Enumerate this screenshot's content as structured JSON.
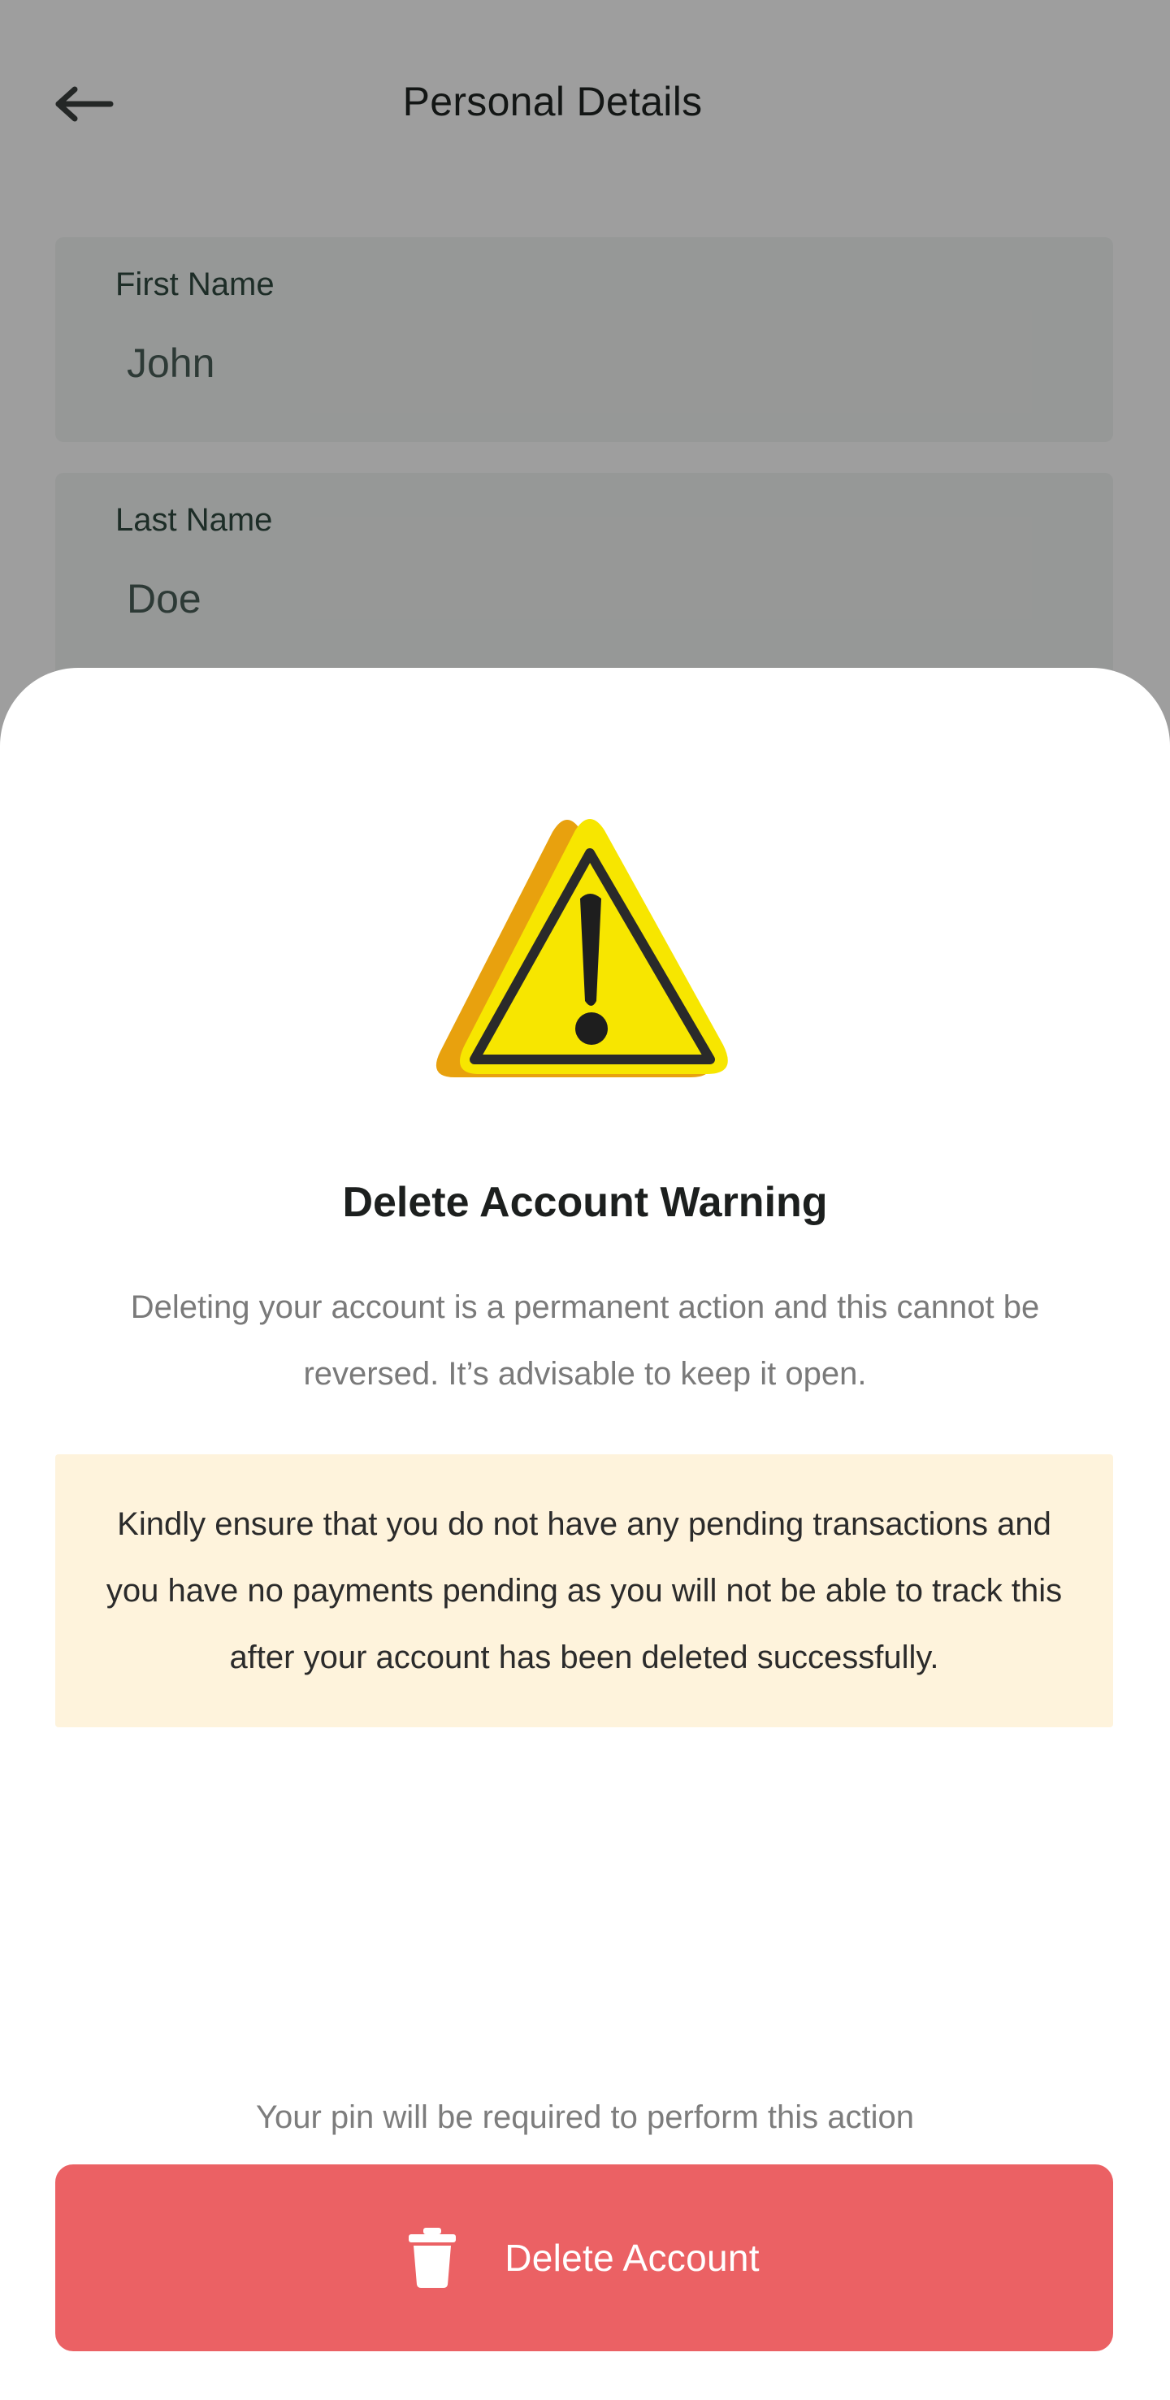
{
  "header": {
    "back_icon": "arrow-left-icon",
    "title": "Personal Details"
  },
  "form": {
    "fields": [
      {
        "label": "First Name",
        "value": "John"
      },
      {
        "label": "Last Name",
        "value": "Doe"
      }
    ]
  },
  "sheet": {
    "illustration": "warning-triangle-icon",
    "title": "Delete Account Warning",
    "description": "Deleting your account is a permanent action and this cannot be reversed. It’s advisable to keep it open.",
    "notice": "Kindly ensure that you do not have any pending transactions and you have no payments pending as you will not be able to track this after your account has been deleted successfully.",
    "pin_note": "Your pin will be required to perform this action",
    "delete_button": {
      "label": "Delete Account",
      "icon": "trash-icon"
    }
  },
  "colors": {
    "danger": "#eb6164",
    "notice_bg": "#fef3dc",
    "warning_yellow": "#f7e600",
    "warning_orange": "#e8a10e"
  }
}
